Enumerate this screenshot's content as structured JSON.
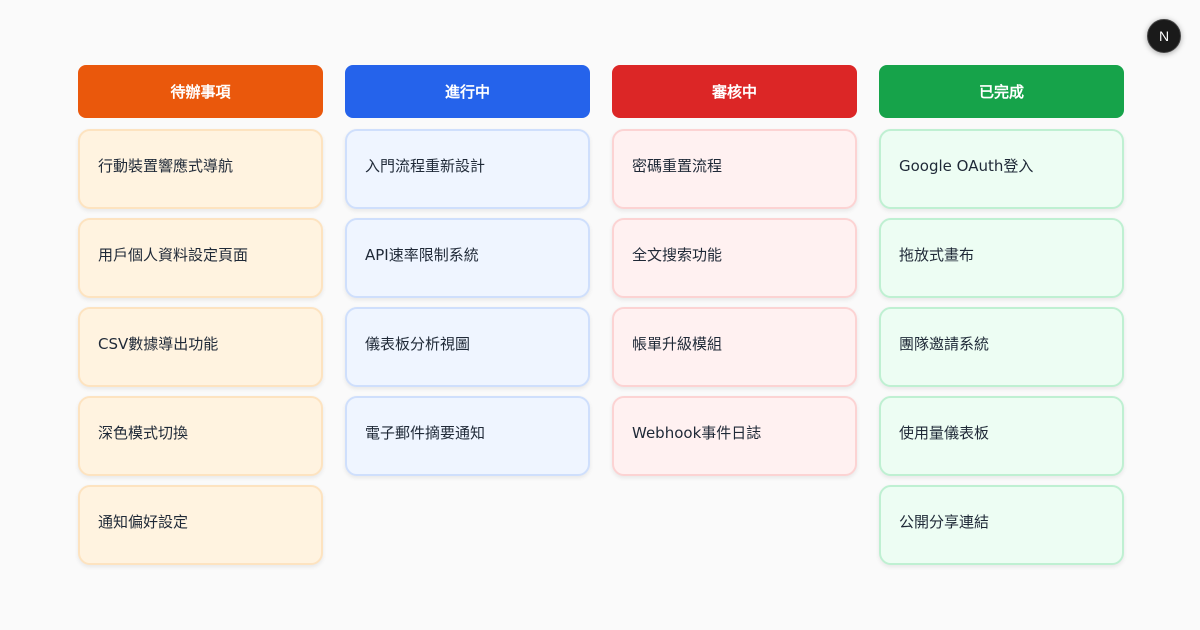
{
  "avatar": {
    "label": "N"
  },
  "columns": [
    {
      "title": "待辦事項",
      "color": "#ea580c",
      "cards": [
        "行動裝置響應式導航",
        "用戶個人資料設定頁面",
        "CSV數據導出功能",
        "深色模式切換",
        "通知偏好設定"
      ]
    },
    {
      "title": "進行中",
      "color": "#2563eb",
      "cards": [
        "入門流程重新設計",
        "API速率限制系統",
        "儀表板分析視圖",
        "電子郵件摘要通知"
      ]
    },
    {
      "title": "審核中",
      "color": "#dc2626",
      "cards": [
        "密碼重置流程",
        "全文搜索功能",
        "帳單升級模組",
        "Webhook事件日誌"
      ]
    },
    {
      "title": "已完成",
      "color": "#16a34a",
      "cards": [
        "Google OAuth登入",
        "拖放式畫布",
        "團隊邀請系統",
        "使用量儀表板",
        "公開分享連結"
      ]
    }
  ]
}
